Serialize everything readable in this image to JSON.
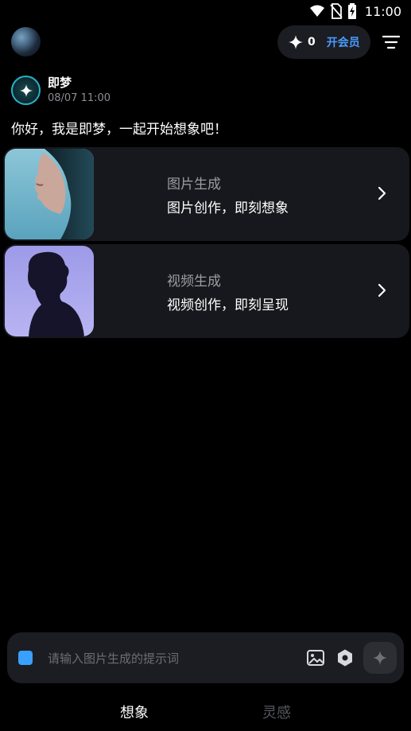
{
  "status": {
    "time": "11:00"
  },
  "header": {
    "credits": "0",
    "vip_label": "开会员"
  },
  "bot": {
    "name": "即梦",
    "timestamp": "08/07 11:00"
  },
  "greeting": "你好，我是即梦，一起开始想象吧！",
  "cards": [
    {
      "title": "图片生成",
      "subtitle": "图片创作，即刻想象"
    },
    {
      "title": "视频生成",
      "subtitle": "视频创作，即刻呈现"
    }
  ],
  "input": {
    "placeholder": "请输入图片生成的提示词"
  },
  "tabs": [
    {
      "label": "想象",
      "active": true
    },
    {
      "label": "灵感",
      "active": false
    }
  ],
  "colors": {
    "accent": "#4a9bff",
    "mode": "#3aa0ff",
    "card_bg": "#16181d"
  },
  "icons": [
    "wifi-icon",
    "no-sim-icon",
    "battery-charging-icon",
    "sparkle-icon",
    "filter-menu-icon",
    "chevron-right-icon",
    "image-upload-icon",
    "hexagon-settings-icon",
    "sparkle-send-icon"
  ]
}
